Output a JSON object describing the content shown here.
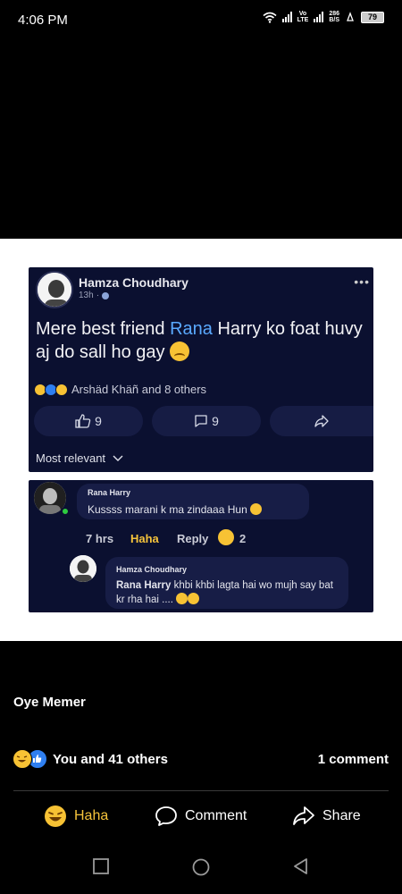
{
  "status_bar": {
    "time": "4:06 PM",
    "data_speed_value": "286",
    "data_speed_unit": "B/S",
    "network_label_top": "Vo",
    "network_label_bottom": "LTE",
    "battery": "79"
  },
  "screenshot_post": {
    "author": "Hamza Choudhary",
    "time": "13h",
    "text_before_mention": "Mere best friend ",
    "mention": "Rana",
    "text_after_mention": " Harry ko foat huvy aj do sall ho gay ",
    "reactions_text": "Arshäd Khäñ and 8 others",
    "like_count": "9",
    "comment_count": "9",
    "sort_label": "Most relevant"
  },
  "screenshot_comments": {
    "comment1": {
      "author": "Rana Harry",
      "text": "Kussss marani k ma zindaaa Hun",
      "time": "7 hrs",
      "reaction_label": "Haha",
      "reply_label": "Reply",
      "reaction_count": "2"
    },
    "reply": {
      "author": "Hamza Choudhary",
      "mention": "Rana Harry",
      "text": " khbi khbi lagta hai wo mujh say bat kr rha hai ...."
    }
  },
  "feed": {
    "caption": "Oye Memer",
    "reactions_text": "You and 41 others",
    "comments_text": "1 comment",
    "actions": {
      "haha": "Haha",
      "comment": "Comment",
      "share": "Share"
    }
  },
  "colors": {
    "mention_blue": "#5aa9ff",
    "haha_yellow": "#f5c33b",
    "post_bg": "#0b1030",
    "like_blue": "#2f7ff0"
  }
}
